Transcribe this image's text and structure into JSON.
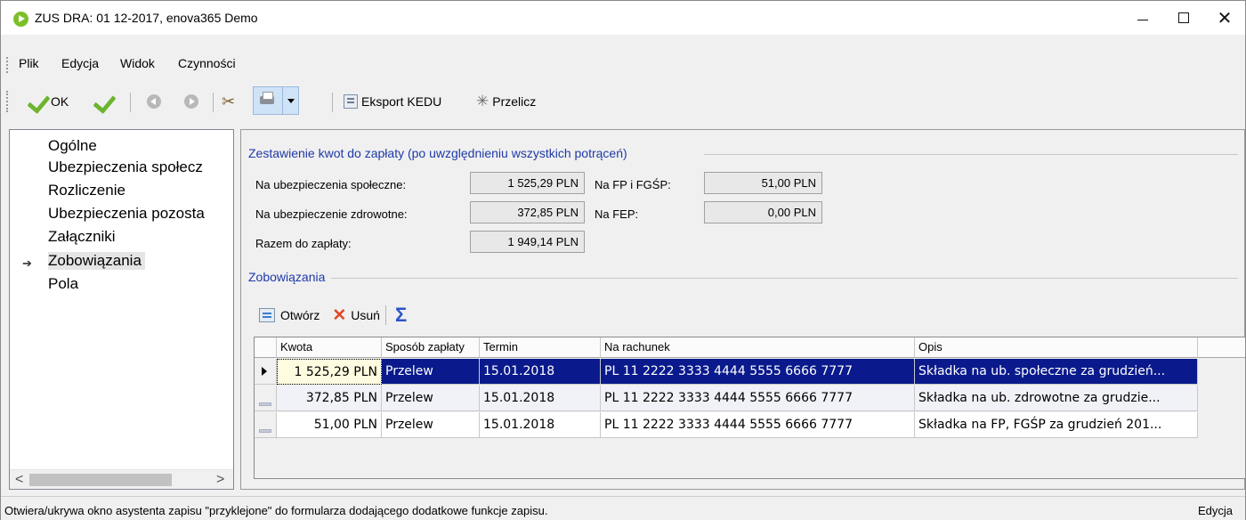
{
  "window": {
    "title": "ZUS DRA: 01 12-2017, enova365 Demo",
    "minimize": "—",
    "maximize": "☐",
    "close": "✕"
  },
  "menu": [
    "Plik",
    "Edycja",
    "Widok",
    "Czynności"
  ],
  "toolbar": {
    "ok_label": "OK",
    "export_label": "Eksport KEDU",
    "recalc_label": "Przelicz",
    "tools_icon": "✂"
  },
  "nav": {
    "items": [
      "Ogólne",
      "Ubezpieczenia społecz",
      "Rozliczenie",
      "Ubezpieczenia pozosta",
      "Załączniki",
      "Zobowiązania",
      "Pola"
    ],
    "selected_index": 5,
    "selected_marker": "➔"
  },
  "summary": {
    "group_title": "Zestawienie kwot do zapłaty (po uwzględnieniu wszystkich potrąceń)",
    "social_label": "Na ubezpieczenia społeczne:",
    "social_value": "1 525,29 PLN",
    "health_label": "Na ubezpieczenie zdrowotne:",
    "health_value": "372,85 PLN",
    "total_label": "Razem do zapłaty:",
    "total_value": "1 949,14 PLN",
    "fp_label": "Na FP i FGŚP:",
    "fp_value": "51,00 PLN",
    "fep_label": "Na FEP:",
    "fep_value": "0,00 PLN"
  },
  "obligations": {
    "group_title": "Zobowiązania",
    "open_label": "Otwórz",
    "delete_label": "Usuń",
    "delete_icon": "✕",
    "sigma_icon": "Σ",
    "columns": [
      "Kwota",
      "Sposób zapłaty",
      "Termin",
      "Na rachunek",
      "Opis"
    ],
    "rows": [
      {
        "amount": "1 525,29 PLN",
        "method": "Przelew",
        "date": "15.01.2018",
        "account": "PL 11 2222 3333 4444 5555 6666 7777",
        "desc": "Składka na ub. społeczne za grudzień..."
      },
      {
        "amount": "372,85 PLN",
        "method": "Przelew",
        "date": "15.01.2018",
        "account": "PL 11 2222 3333 4444 5555 6666 7777",
        "desc": "Składka na ub. zdrowotne za grudzie..."
      },
      {
        "amount": "51,00 PLN",
        "method": "Przelew",
        "date": "15.01.2018",
        "account": "PL 11 2222 3333 4444 5555 6666 7777",
        "desc": "Składka na FP, FGŚP za grudzień 201..."
      }
    ],
    "selected_row": 0
  },
  "scroll": {
    "left": "<",
    "right": ">"
  },
  "status": {
    "text": "Otwiera/ukrywa okno asystenta zapisu \"przyklejone\" do formularza dodającego dodatkowe funkcje zapisu.",
    "mode": "Edycja"
  },
  "colors": {
    "accent": "#0a1a8c",
    "group_title": "#1e3aa8",
    "ok_green": "#6cb52d",
    "delete_red": "#e04a2a"
  }
}
